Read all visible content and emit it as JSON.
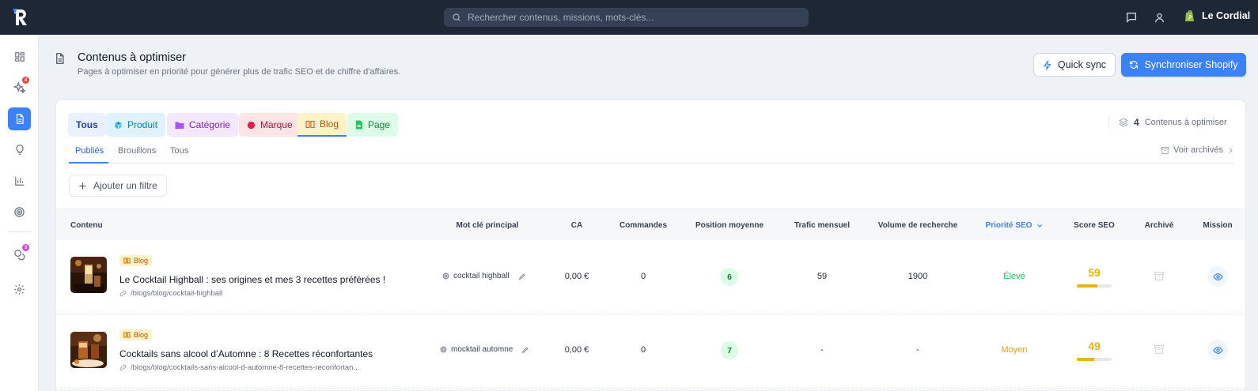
{
  "app": {
    "search_placeholder": "Rechercher contenus, missions, mots-clés...",
    "store_name": "Le Cordial"
  },
  "sidebar": {
    "items": [
      {
        "icon": "dashboard-icon",
        "badge": ""
      },
      {
        "icon": "sparkles-icon",
        "badge": "4"
      },
      {
        "icon": "document-icon",
        "badge": "",
        "active": true
      },
      {
        "icon": "lightbulb-icon",
        "badge": ""
      },
      {
        "icon": "bar-chart-icon",
        "badge": ""
      },
      {
        "icon": "target-icon",
        "badge": ""
      },
      {
        "icon": "coins-icon",
        "badge": "3"
      },
      {
        "icon": "gear-icon",
        "badge": ""
      }
    ]
  },
  "header": {
    "title": "Contenus à optimiser",
    "subtitle": "Pages à optimiser en priorité pour générer plus de trafic SEO et de chiffre d'affaires.",
    "quick_sync": "Quick sync",
    "sync_shopify": "Synchroniser Shopify"
  },
  "type_tabs": {
    "all": "Tous",
    "product": "Produit",
    "category": "Catégorie",
    "brand": "Marque",
    "blog": "Blog",
    "page": "Page"
  },
  "counter": {
    "count": "4",
    "label": "Contenus à optimiser"
  },
  "status_tabs": {
    "published": "Publiés",
    "drafts": "Brouillons",
    "all": "Tous",
    "archived": "Voir archivés"
  },
  "add_filter": "Ajouter un filtre",
  "columns": {
    "content": "Contenu",
    "keyword": "Mot clé principal",
    "revenue": "CA",
    "orders": "Commandes",
    "position": "Position moyenne",
    "traffic": "Trafic mensuel",
    "volume": "Volume de recherche",
    "priority": "Priorité SEO",
    "score": "Score SEO",
    "archived": "Archivé",
    "mission": "Mission"
  },
  "rows": [
    {
      "type": "Blog",
      "title": "Le Cocktail Highball : ses origines et mes 3 recettes préférées !",
      "path": "/blogs/blog/cocktail-highball",
      "keyword": "cocktail highball",
      "revenue": "0,00 €",
      "orders": "0",
      "position": "6",
      "traffic": "59",
      "volume": "1900",
      "priority": "Élevé",
      "priority_color": "#22c55e",
      "score": "59",
      "score_value": 59
    },
    {
      "type": "Blog",
      "title": "Cocktails sans alcool d’Automne : 8 Recettes réconfortantes",
      "path": "/blogs/blog/cocktails-sans-alcool-d-automne-8-recettes-reconfortan...",
      "keyword": "mocktail automne",
      "revenue": "0,00 €",
      "orders": "0",
      "position": "7",
      "traffic": "-",
      "volume": "-",
      "priority": "Moyen",
      "priority_color": "#f59e0b",
      "score": "49",
      "score_value": 49
    }
  ]
}
